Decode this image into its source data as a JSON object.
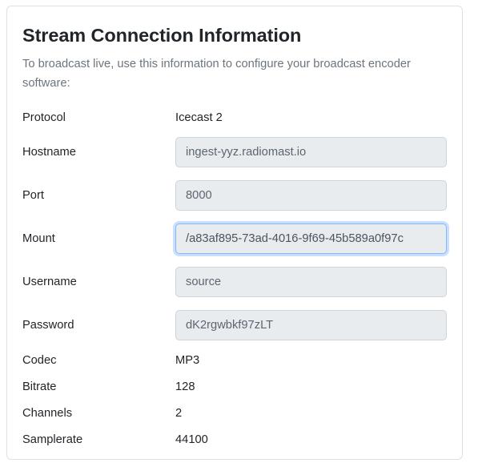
{
  "card": {
    "title": "Stream Connection Information",
    "subtitle": "To broadcast live, use this information to configure your broadcast encoder software:",
    "accent_color": "#0d6efd",
    "focus_border_color": "#86b7fe",
    "field_background": "#e9ecef",
    "border_color": "#dee2e6",
    "muted_text_color": "#6c757d"
  },
  "fields": {
    "protocol": {
      "label": "Protocol",
      "value": "Icecast 2",
      "type": "text"
    },
    "hostname": {
      "label": "Hostname",
      "value": "ingest-yyz.radiomast.io",
      "type": "input",
      "focused": false
    },
    "port": {
      "label": "Port",
      "value": "8000",
      "type": "input",
      "focused": false
    },
    "mount": {
      "label": "Mount",
      "value": "/a83af895-73ad-4016-9f69-45b589a0f97c",
      "type": "input",
      "focused": true
    },
    "username": {
      "label": "Username",
      "value": "source",
      "type": "input",
      "focused": false
    },
    "password": {
      "label": "Password",
      "value": "dK2rgwbkf97zLT",
      "type": "input",
      "focused": false
    },
    "codec": {
      "label": "Codec",
      "value": "MP3",
      "type": "text"
    },
    "bitrate": {
      "label": "Bitrate",
      "value": "128",
      "type": "text"
    },
    "channels": {
      "label": "Channels",
      "value": "2",
      "type": "text"
    },
    "samplerate": {
      "label": "Samplerate",
      "value": "44100",
      "type": "text"
    }
  }
}
